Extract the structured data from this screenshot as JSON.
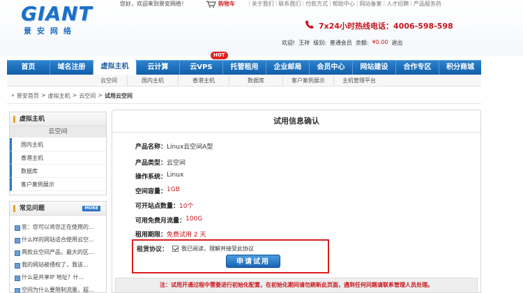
{
  "header": {
    "logo_main": "GIANT",
    "logo_sub": "景安网络",
    "welcome": "您好，欢迎来到景安网络！",
    "cart": "购物车",
    "top_links": [
      "关于我们",
      "联系我们",
      "付款方式",
      "帮助中心",
      "网站备案",
      "人才招聘",
      "产品服务药"
    ],
    "hotline": "7x24小时热线电话：4006-598-598",
    "user": {
      "greet": "欢迎!",
      "name": "王祥",
      "level_label": "级别:",
      "level": "普通会员",
      "balance_label": "余额:",
      "balance": "¥0.00",
      "logout": "退出"
    }
  },
  "nav": {
    "items": [
      "首页",
      "域名注册",
      "虚拟主机",
      "云计算",
      "云VPS",
      "托管租用",
      "企业邮局",
      "会员中心",
      "网站建设",
      "合作专区",
      "积分商城"
    ],
    "active": "虚拟主机",
    "hot_badge": "HOT",
    "sub_items": [
      "云空间",
      "国内主机",
      "香港主机",
      "数据库",
      "客户案例展示",
      "主机管理平台"
    ]
  },
  "breadcrumb": [
    "景安首页",
    "虚拟主机",
    "云空间",
    "试用云空间"
  ],
  "sidebar": {
    "section_title": "虚拟主机",
    "selected": "云空间",
    "items": [
      "国内主机",
      "香港主机",
      "数据库",
      "客户案例展示"
    ],
    "faq_title": "常见问题",
    "faq_more": "MORE",
    "faq": [
      "答：您可以将您正在使用的...",
      "什么样的网站适合使用云空...",
      "两款云空间产品，最大的区...",
      "我的网站被侵权了，我该...",
      "什么是共享IP 地址？什...",
      "空间为什么要限制流量，超..."
    ]
  },
  "main": {
    "title": "试用信息确认",
    "fields": [
      {
        "label": "产品名称：",
        "value": "Linux云空间A型",
        "red": false
      },
      {
        "label": "产品类型：",
        "value": "云空间",
        "red": false
      },
      {
        "label": "操作系统：",
        "value": "Linux",
        "red": false
      },
      {
        "label": "空间容量：",
        "value": "1GB",
        "red": true
      },
      {
        "label": "可开站点数量：",
        "value": "10个",
        "red": true
      },
      {
        "label": "可用免费月流量：",
        "value": "100G",
        "red": true
      },
      {
        "label": "租用期限：",
        "value": "免费试用 2 天",
        "red": true
      }
    ],
    "agree_label": "租赁协议：",
    "agree_text": "我已阅读，理解并接受此协议",
    "agree_checked": true,
    "apply_button": "申请试用",
    "notice": "注：试用开通过程中需要进行初始化配置，在初始化期间请勿刷新此页面，遇到任何问题请联系管理人员处理。"
  }
}
